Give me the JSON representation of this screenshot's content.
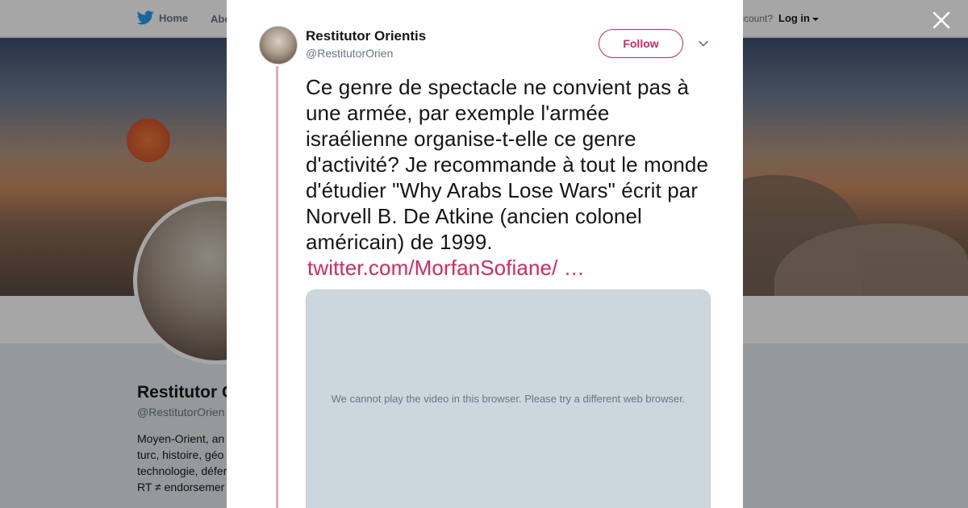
{
  "nav": {
    "home_label": "Home",
    "about_label": "Abo",
    "account_text": "ccount?",
    "login_label": "Log in"
  },
  "profile": {
    "name": "Restitutor O",
    "handle": "@RestitutorOrien",
    "bio_lines": [
      "Moyen-Orient, an",
      "turc, histoire, géo",
      "technologie, défer",
      "RT ≠ endorsemer"
    ]
  },
  "tweet": {
    "author_name": "Restitutor Orientis",
    "author_handle": "@RestitutorOrien",
    "follow_label": "Follow",
    "text": "Ce genre de spectacle ne convient pas à une armée, par exemple l'armée israélienne organise-t-elle ce genre d'activité? Je recommande à tout le monde d'étudier \"Why Arabs Lose Wars\" écrit par Norvell B. De Atkine (ancien colonel américain) de 1999.",
    "link": "twitter.com/MorfanSofiane/ …",
    "media_message": "We cannot play the video in this browser. Please try a different web browser."
  },
  "colors": {
    "accent": "#e0245e",
    "thread_line": "#e8a9b9",
    "twitter_blue": "#1da1f2"
  },
  "icons": [
    "twitter-bird-icon",
    "caret-down-icon",
    "close-icon",
    "chevron-down-icon"
  ]
}
